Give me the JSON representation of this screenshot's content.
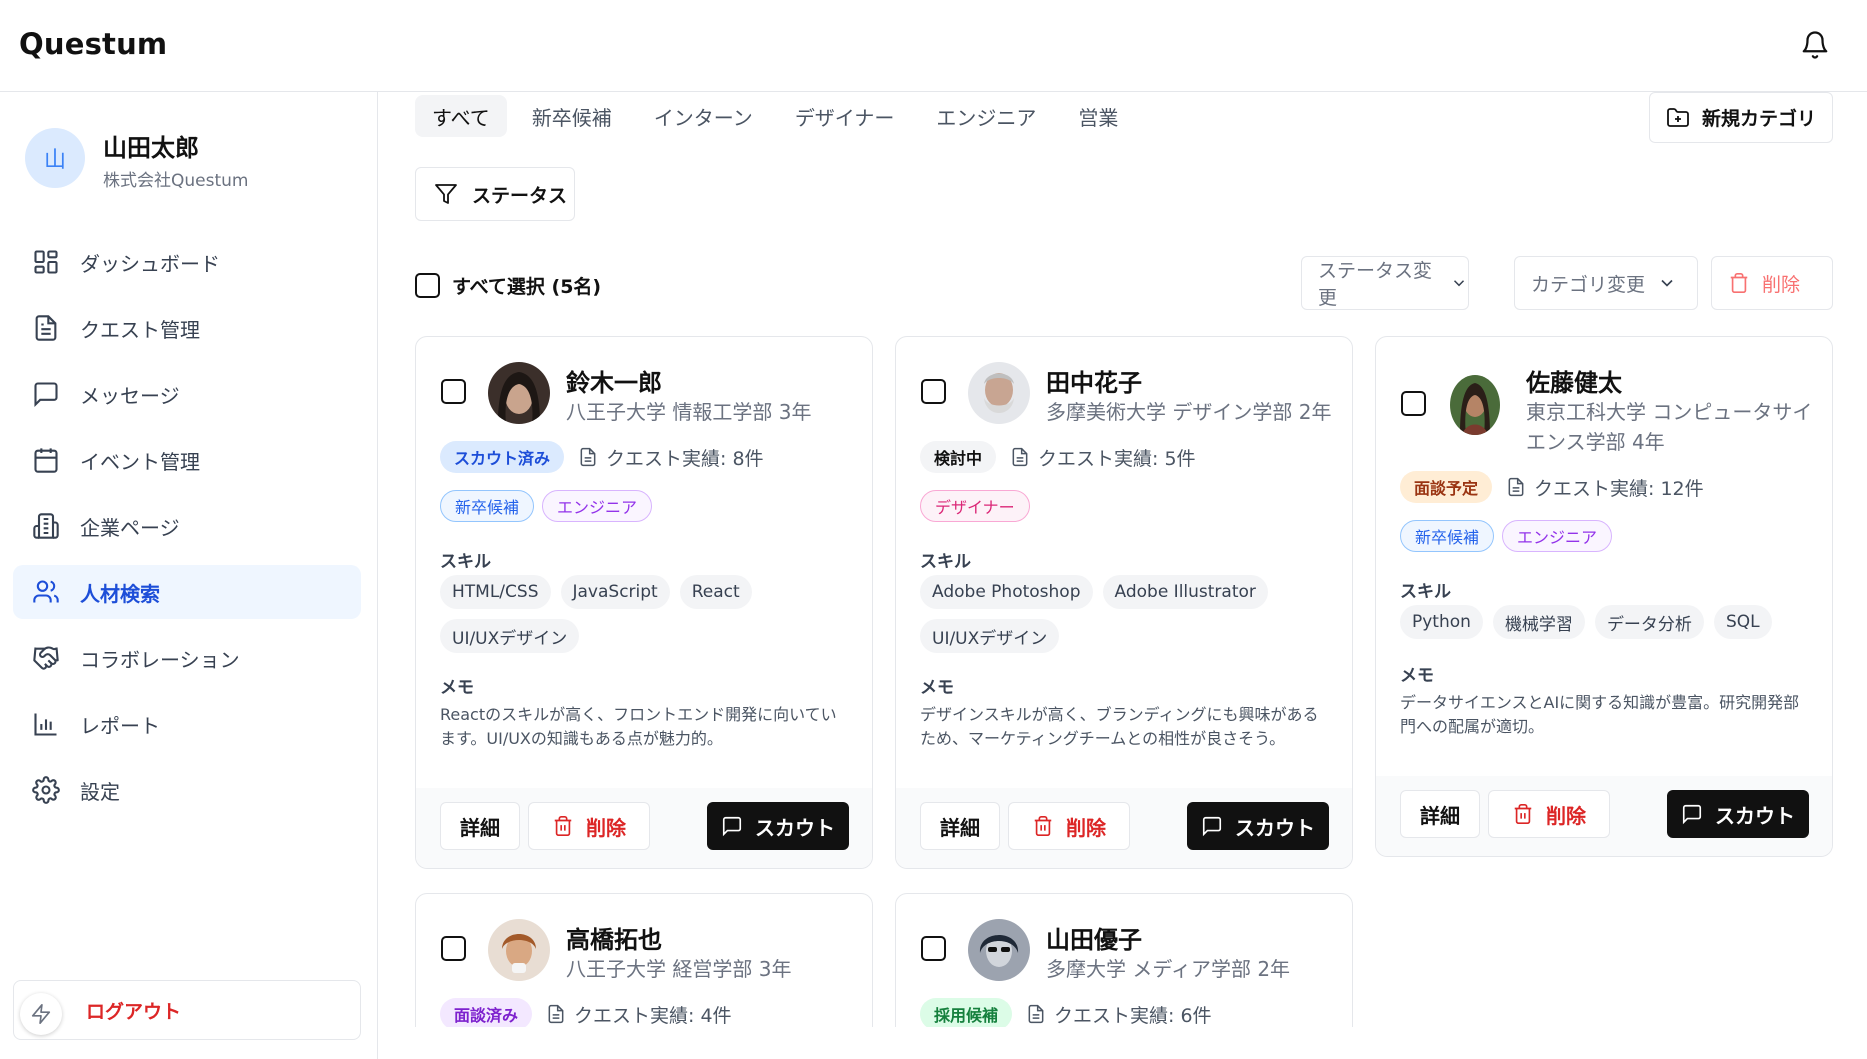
{
  "app": {
    "title": "Questum"
  },
  "user": {
    "initial": "山",
    "name": "山田太郎",
    "company": "株式会社Questum"
  },
  "nav": [
    {
      "label": "ダッシュボード",
      "icon": "dashboard-icon"
    },
    {
      "label": "クエスト管理",
      "icon": "document-icon"
    },
    {
      "label": "メッセージ",
      "icon": "message-icon"
    },
    {
      "label": "イベント管理",
      "icon": "calendar-icon"
    },
    {
      "label": "企業ページ",
      "icon": "building-icon"
    },
    {
      "label": "人材検索",
      "icon": "users-icon",
      "active": true
    },
    {
      "label": "コラボレーション",
      "icon": "handshake-icon"
    },
    {
      "label": "レポート",
      "icon": "bar-chart-icon"
    },
    {
      "label": "設定",
      "icon": "gear-icon"
    }
  ],
  "logout": {
    "label": "ログアウト"
  },
  "tabs": [
    "すべて",
    "新卒候補",
    "インターン",
    "デザイナー",
    "エンジニア",
    "営業"
  ],
  "new_category_label": "新規カテゴリ",
  "status_filter_label": "ステータス",
  "select_all_label": "すべて選択 (5名)",
  "bulk": {
    "status_change": "ステータス変更",
    "category_change": "カテゴリ変更",
    "delete": "削除"
  },
  "card_labels": {
    "skills": "スキル",
    "memo": "メモ",
    "detail": "詳細",
    "delete": "削除",
    "scout": "スカウト"
  },
  "candidates": [
    {
      "name": "鈴木一郎",
      "school": "八王子大学 情報工学部 3年",
      "status": "スカウト済み",
      "status_color": "#dbeafe",
      "status_text_color": "#1d4ed8",
      "quests": "クエスト実績: 8件",
      "categories": [
        {
          "label": "新卒候補",
          "style": "blue"
        },
        {
          "label": "エンジニア",
          "style": "purple"
        }
      ],
      "skills": [
        "HTML/CSS",
        "JavaScript",
        "React",
        "UI/UXデザイン"
      ],
      "memo": "Reactのスキルが高く、フロントエンド開発に向いています。UI/UXの知識もある点が魅力的。"
    },
    {
      "name": "田中花子",
      "school": "多摩美術大学 デザイン学部 2年",
      "status": "検討中",
      "status_color": "#f3f4f6",
      "status_text_color": "#111111",
      "quests": "クエスト実績: 5件",
      "categories": [
        {
          "label": "デザイナー",
          "style": "pink"
        }
      ],
      "skills": [
        "Adobe Photoshop",
        "Adobe Illustrator",
        "UI/UXデザイン"
      ],
      "memo": "デザインスキルが高く、ブランディングにも興味があるため、マーケティングチームとの相性が良さそう。"
    },
    {
      "name": "佐藤健太",
      "school": "東京工科大学 コンピュータサイエンス学部 4年",
      "status": "面談予定",
      "status_color": "#ffedd5",
      "status_text_color": "#9a3412",
      "quests": "クエスト実績: 12件",
      "categories": [
        {
          "label": "新卒候補",
          "style": "blue"
        },
        {
          "label": "エンジニア",
          "style": "purple"
        }
      ],
      "skills": [
        "Python",
        "機械学習",
        "データ分析",
        "SQL"
      ],
      "memo": "データサイエンスとAIに関する知識が豊富。研究開発部門への配属が適切。"
    },
    {
      "name": "高橋拓也",
      "school": "八王子大学 経営学部 3年",
      "status": "面談済み",
      "status_color": "#f3e8ff",
      "status_text_color": "#7e22ce",
      "quests": "クエスト実績: 4件"
    },
    {
      "name": "山田優子",
      "school": "多摩大学 メディア学部 2年",
      "status": "採用候補",
      "status_color": "#dcfce7",
      "status_text_color": "#15803d",
      "quests": "クエスト実績: 6件"
    }
  ]
}
